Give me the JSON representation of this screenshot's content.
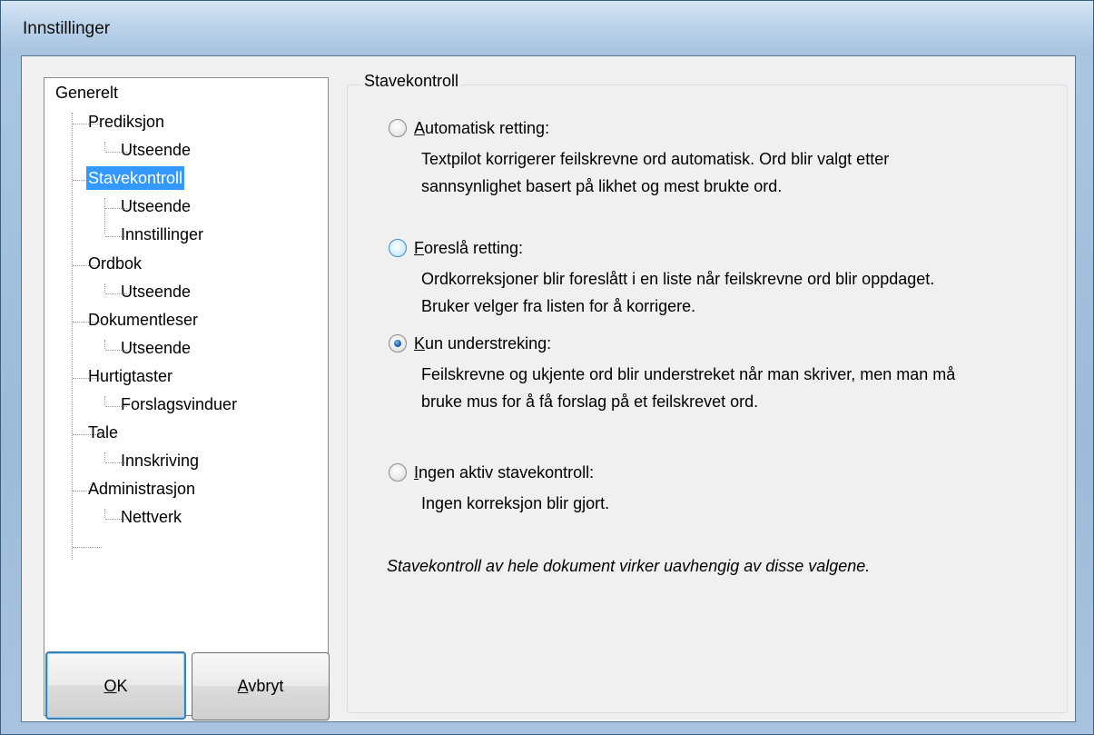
{
  "window": {
    "title": "Innstillinger"
  },
  "tree": {
    "items": [
      {
        "label": "Generelt",
        "level": 0
      },
      {
        "label": "Prediksjon",
        "level": 1
      },
      {
        "label": "Utseende",
        "level": 2
      },
      {
        "label": "Stavekontroll",
        "level": 1,
        "selected": true
      },
      {
        "label": "Utseende",
        "level": 2
      },
      {
        "label": "Innstillinger",
        "level": 2
      },
      {
        "label": "Ordbok",
        "level": 1
      },
      {
        "label": "Utseende",
        "level": 2
      },
      {
        "label": "Dokumentleser",
        "level": 1
      },
      {
        "label": "Utseende",
        "level": 2
      },
      {
        "label": "Hurtigtaster",
        "level": 1
      },
      {
        "label": "Forslagsvinduer",
        "level": 2
      },
      {
        "label": "Tale",
        "level": 1
      },
      {
        "label": "Innskriving",
        "level": 2
      },
      {
        "label": "Administrasjon",
        "level": 1
      },
      {
        "label": "Nettverk",
        "level": 2
      }
    ]
  },
  "buttons": {
    "ok_mnemonic": "O",
    "ok_rest": "K",
    "cancel_mnemonic": "A",
    "cancel_rest": "vbryt"
  },
  "group": {
    "label": "Stavekontroll"
  },
  "options": [
    {
      "mnemonic": "A",
      "rest": "utomatisk retting:",
      "desc": "Textpilot korrigerer feilskrevne ord automatisk. Ord blir valgt etter sannsynlighet basert på likhet og mest brukte ord.",
      "checked": false
    },
    {
      "mnemonic": "F",
      "rest": "oreslå retting:",
      "desc": "Ordkorreksjoner blir foreslått i en liste når feilskrevne ord blir oppdaget. Bruker velger fra listen for å korrigere.",
      "checked": false
    },
    {
      "mnemonic": "K",
      "rest": "un understreking:",
      "desc": "Feilskrevne og ukjente ord blir understreket når man skriver, men man må bruke mus for å få forslag på et feilskrevet ord.",
      "checked": true
    },
    {
      "mnemonic": "I",
      "rest": "ngen aktiv stavekontroll:",
      "desc": "Ingen korreksjon blir gjort.",
      "checked": false
    }
  ],
  "note": "Stavekontroll av hele dokument virker uavhengig av disse valgene."
}
